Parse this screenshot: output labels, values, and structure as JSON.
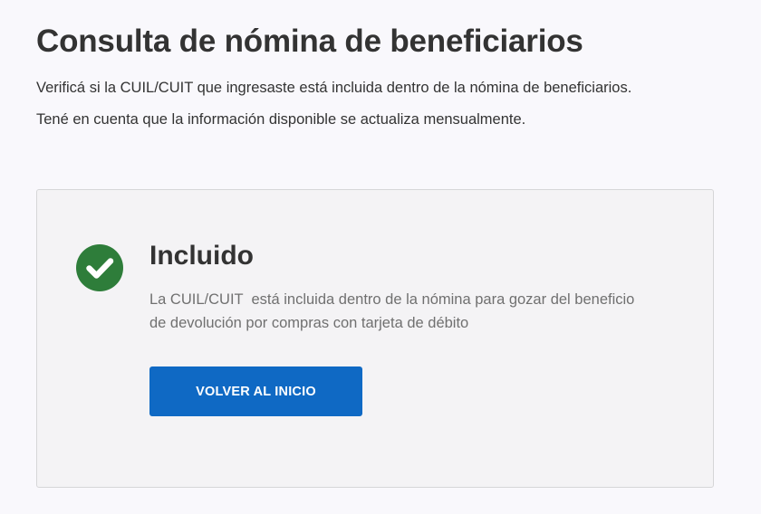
{
  "page": {
    "title": "Consulta de nómina de beneficiarios",
    "intro_lines": [
      "Verificá si la CUIL/CUIT que ingresaste está incluida dentro de la nómina de beneficiarios.",
      "Tené en cuenta que la información disponible se actualiza mensualmente."
    ]
  },
  "result": {
    "icon": "check-circle-icon",
    "status": "Incluido",
    "description": "La CUIL/CUIT  está incluida dentro de la nómina para gozar del beneficio\nde devolución por compras con tarjeta de débito",
    "button_label": "VOLVER AL INICIO"
  },
  "colors": {
    "success": "#2e7d3a",
    "primary_button": "#0f69c4",
    "card_background": "#f4f3f5",
    "page_background": "#f9f8fc"
  }
}
